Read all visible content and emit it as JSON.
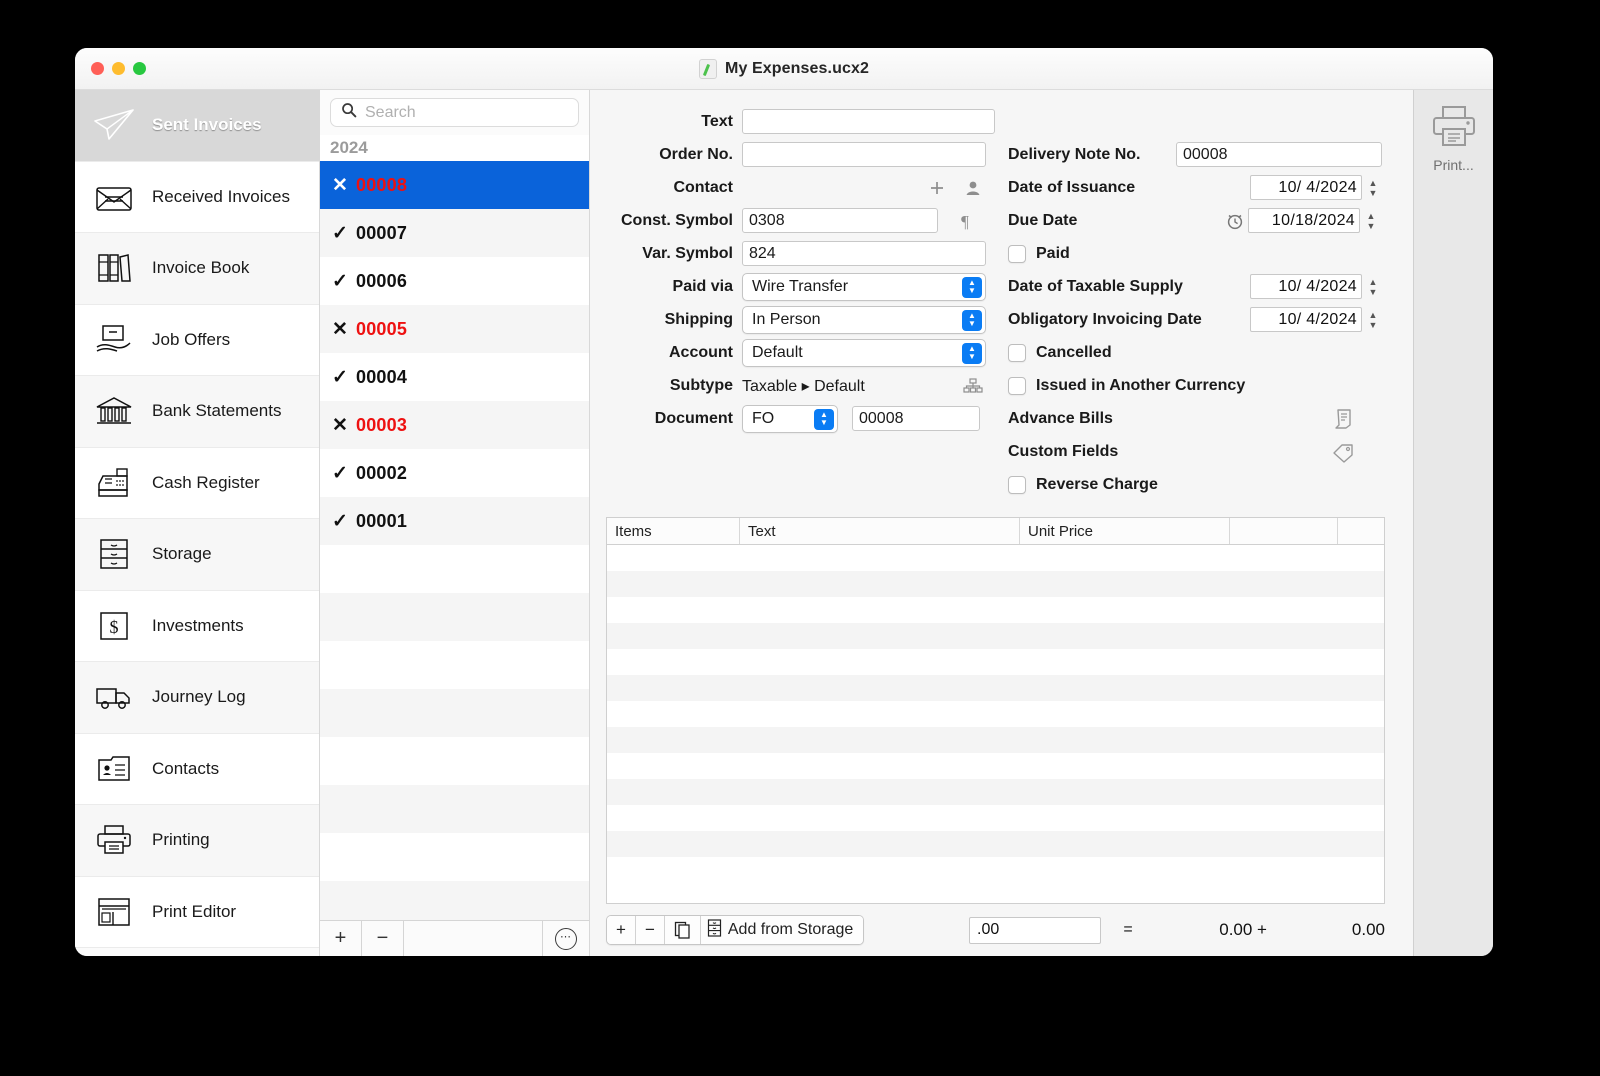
{
  "window": {
    "title": "My Expenses.ucx2",
    "doc_icon": "document-icon",
    "traffic_lights": [
      "close",
      "minimize",
      "zoom"
    ]
  },
  "sidebar": {
    "items": [
      {
        "label": "Sent Invoices",
        "icon": "paper-plane-icon",
        "selected": true
      },
      {
        "label": "Received Invoices",
        "icon": "envelope-icon",
        "selected": false
      },
      {
        "label": "Invoice Book",
        "icon": "books-icon",
        "selected": false
      },
      {
        "label": "Job Offers",
        "icon": "hand-box-icon",
        "selected": false
      },
      {
        "label": "Bank Statements",
        "icon": "bank-icon",
        "selected": false
      },
      {
        "label": "Cash Register",
        "icon": "cash-register-icon",
        "selected": false
      },
      {
        "label": "Storage",
        "icon": "drawers-icon",
        "selected": false
      },
      {
        "label": "Investments",
        "icon": "dollar-icon",
        "selected": false
      },
      {
        "label": "Journey Log",
        "icon": "truck-icon",
        "selected": false
      },
      {
        "label": "Contacts",
        "icon": "contact-card-icon",
        "selected": false
      },
      {
        "label": "Printing",
        "icon": "printer-icon",
        "selected": false
      },
      {
        "label": "Print Editor",
        "icon": "layout-icon",
        "selected": false
      }
    ]
  },
  "list": {
    "search": {
      "placeholder": "Search",
      "value": "",
      "icon": "search-icon"
    },
    "group_label": "2024",
    "rows": [
      {
        "mark": "✕",
        "number": "00008",
        "state": "unpaid",
        "selected": true
      },
      {
        "mark": "✓",
        "number": "00007",
        "state": "paid",
        "selected": false
      },
      {
        "mark": "✓",
        "number": "00006",
        "state": "paid",
        "selected": false
      },
      {
        "mark": "✕",
        "number": "00005",
        "state": "unpaid",
        "selected": false
      },
      {
        "mark": "✓",
        "number": "00004",
        "state": "paid",
        "selected": false
      },
      {
        "mark": "✕",
        "number": "00003",
        "state": "unpaid",
        "selected": false
      },
      {
        "mark": "✓",
        "number": "00002",
        "state": "paid",
        "selected": false
      },
      {
        "mark": "✓",
        "number": "00001",
        "state": "paid",
        "selected": false
      }
    ],
    "footer": {
      "add": "+",
      "remove": "−",
      "more": "⋯"
    }
  },
  "form": {
    "left": {
      "text_label": "Text",
      "text_value": "",
      "order_no_label": "Order No.",
      "order_no_value": "",
      "contact_label": "Contact",
      "contact_add_icon": "plus-icon",
      "contact_person_icon": "person-icon",
      "const_symbol_label": "Const. Symbol",
      "const_symbol_value": "0308",
      "pilcrow_icon": "pilcrow-icon",
      "var_symbol_label": "Var. Symbol",
      "var_symbol_value": "824",
      "paid_via_label": "Paid via",
      "paid_via_value": "Wire Transfer",
      "shipping_label": "Shipping",
      "shipping_value": "In Person",
      "account_label": "Account",
      "account_value": "Default",
      "subtype_label": "Subtype",
      "subtype_value": "Taxable ▸ Default",
      "subtype_icon": "hierarchy-icon",
      "document_label": "Document",
      "document_type": "FO",
      "document_number": "00008"
    },
    "right": {
      "delivery_note_label": "Delivery Note No.",
      "delivery_note_value": "00008",
      "date_issuance_label": "Date of Issuance",
      "date_issuance_value": "10/  4/2024",
      "due_date_label": "Due Date",
      "due_date_value": "10/18/2024",
      "due_date_icon": "alarm-clock-icon",
      "paid_label": "Paid",
      "paid_checked": false,
      "taxable_supply_label": "Date of Taxable Supply",
      "taxable_supply_value": "10/  4/2024",
      "obligatory_label": "Obligatory Invoicing Date",
      "obligatory_value": "10/  4/2024",
      "cancelled_label": "Cancelled",
      "cancelled_checked": false,
      "another_currency_label": "Issued in Another Currency",
      "another_currency_checked": false,
      "advance_bills_label": "Advance Bills",
      "advance_bills_icon": "receipt-icon",
      "custom_fields_label": "Custom Fields",
      "custom_fields_icon": "tag-icon",
      "reverse_charge_label": "Reverse Charge",
      "reverse_charge_checked": false
    }
  },
  "items_table": {
    "columns": [
      "Items",
      "Text",
      "Unit Price",
      "",
      ""
    ],
    "rows": []
  },
  "bottom": {
    "add_icon": "+",
    "remove_icon": "−",
    "duplicate_icon": "duplicate-icon",
    "storage_icon": "drawers-icon",
    "add_from_storage_label": "Add from Storage",
    "amount_value": ".00",
    "equals": "=",
    "total_net": "0.00 +",
    "total_tax": "0.00"
  },
  "print_rail": {
    "label": "Print...",
    "icon": "printer-icon"
  },
  "colors": {
    "accent_blue": "#0a63da",
    "control_blue": "#0a7cf4",
    "unpaid_red": "#ee1111",
    "window_bg": "#f6f6f6"
  }
}
